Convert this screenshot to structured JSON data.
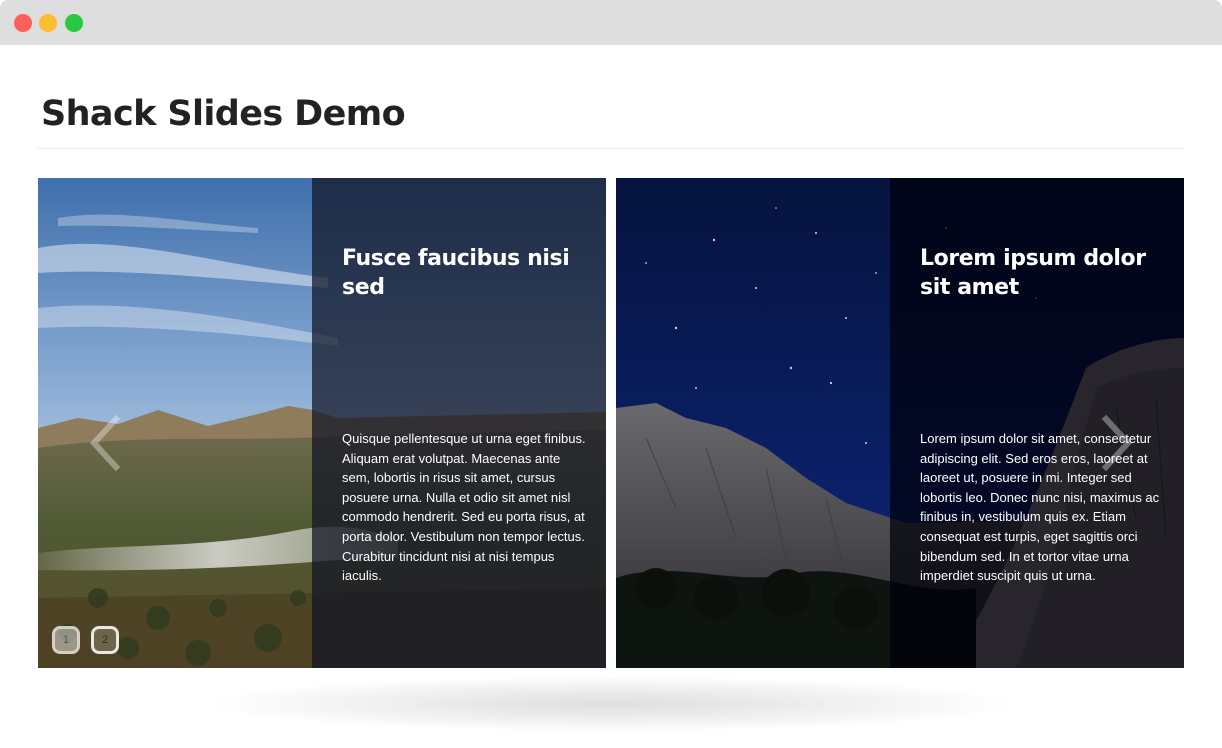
{
  "window": {
    "controls": [
      "close",
      "minimize",
      "maximize"
    ]
  },
  "page": {
    "title": "Shack Slides Demo"
  },
  "slides": [
    {
      "title": "Fusce faucibus nisi sed",
      "body": "Quisque pellentesque ut urna eget finibus. Aliquam erat volutpat. Maecenas ante sem, lobortis in risus sit amet, cursus posuere urna. Nulla et odio sit amet nisl commodo hendrerit. Sed eu porta risus, at porta dolor. Vestibulum non tempor lectus. Curabitur tincidunt nisi at nisi tempus iaculis.",
      "image": "mountain valley landscape at sunrise"
    },
    {
      "title": "Lorem ipsum dolor sit amet",
      "body": "Lorem ipsum dolor sit amet, consectetur adipiscing elit. Sed eros eros, laoreet at laoreet ut, posuere in mi. Integer sed lobortis leo. Donec nunc nisi, maximus ac finibus in, vestibulum quis ex. Etiam consequat est turpis, eget sagittis orci bibendum sed. In et tortor vitae urna imperdiet suscipit quis ut urna.",
      "image": "starry night sky over granite cliffs"
    }
  ],
  "pagination": [
    "1",
    "2"
  ],
  "icons": {
    "prev": "chevron-left-icon",
    "next": "chevron-right-icon"
  },
  "colors": {
    "close": "#fe5f57",
    "minimize": "#febc2e",
    "maximize": "#28c840",
    "titlebar": "#dedede",
    "heading": "#222222"
  }
}
